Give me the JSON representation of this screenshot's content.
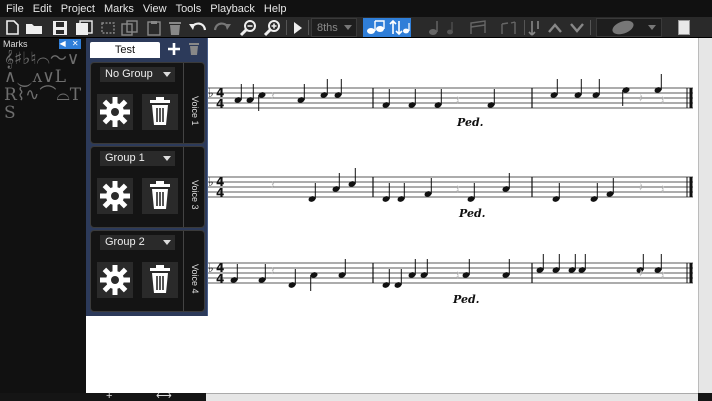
{
  "menu": [
    "File",
    "Edit",
    "Project",
    "Marks",
    "View",
    "Tools",
    "Playback",
    "Help"
  ],
  "toolbar": {
    "duration_select": "8ths",
    "icons": [
      "new-file-icon",
      "open-folder-icon",
      "save-icon",
      "save-as-icon",
      "cut-icon",
      "copy-icon",
      "paste-icon",
      "delete-icon",
      "undo-icon",
      "redo-icon",
      "zoom-out-icon",
      "zoom-in-icon",
      "play-icon"
    ]
  },
  "marks": {
    "title": "Marks",
    "close_label": "◀ ✕",
    "glyphs": "𝄞♯♭♮⌒〜∨∧‿ʌ∨L R⌇∿⌒⌓T S"
  },
  "voice_panel": {
    "tab_label": "Test",
    "voices": [
      {
        "group": "No Group",
        "label": "Voice 1"
      },
      {
        "group": "Group 1",
        "label": "Voice 3"
      },
      {
        "group": "Group 2",
        "label": "Voice 4"
      }
    ]
  },
  "score": {
    "pedal_marks": [
      "Ped.",
      "Ped.",
      "Ped."
    ],
    "time_signature": "4/4"
  },
  "bottom_bar": {
    "add": "+",
    "resize": "⟷"
  }
}
